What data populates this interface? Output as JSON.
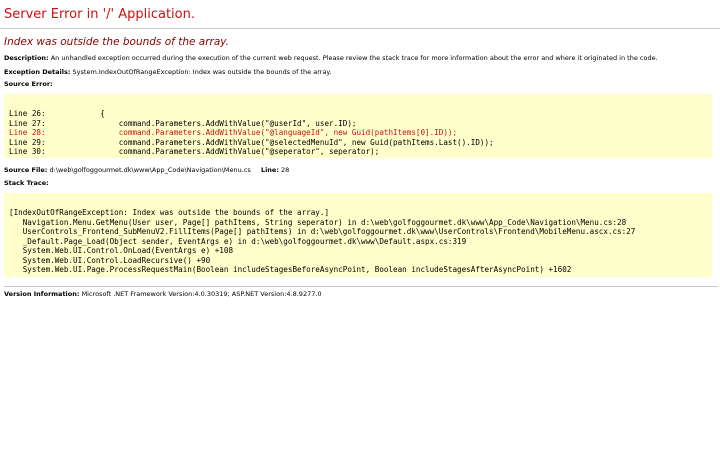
{
  "header": {
    "title": "Server Error in '/' Application.",
    "subtitle": "Index was outside the bounds of the array."
  },
  "description": {
    "label": "Description:",
    "text": "An unhandled exception occurred during the execution of the current web request. Please review the stack trace for more information about the error and where it originated in the code."
  },
  "exception": {
    "label": "Exception Details:",
    "text": "System.IndexOutOfRangeException: Index was outside the bounds of the array."
  },
  "source_error": {
    "label": "Source Error:",
    "lines": [
      "Line 26:            {",
      "Line 27:                command.Parameters.AddWithValue(\"@userId\", user.ID);",
      "Line 28:                command.Parameters.AddWithValue(\"@languageId\", new Guid(pathItems[0].ID));",
      "Line 29:                command.Parameters.AddWithValue(\"@selectedMenuId\", new Guid(pathItems.Last().ID));",
      "Line 30:                command.Parameters.AddWithValue(\"@seperator\", seperator);"
    ],
    "highlight_color": "#cc1111"
  },
  "source_file": {
    "label": "Source File:",
    "path": "d:\\web\\golfoggourmet.dk\\www\\App_Code\\Navigation\\Menu.cs",
    "line_label": "Line:",
    "line": "28"
  },
  "stack_trace": {
    "label": "Stack Trace:",
    "lines": [
      "[IndexOutOfRangeException: Index was outside the bounds of the array.]",
      "   Navigation.Menu.GetMenu(User user, Page[] pathItems, String seperator) in d:\\web\\golfoggourmet.dk\\www\\App_Code\\Navigation\\Menu.cs:28",
      "   UserControls_Frontend_SubMenuV2.FillItems(Page[] pathItems) in d:\\web\\golfoggourmet.dk\\www\\UserControls\\Frontend\\MobileMenu.ascx.cs:27",
      "   _Default.Page_Load(Object sender, EventArgs e) in d:\\web\\golfoggourmet.dk\\www\\Default.aspx.cs:319",
      "   System.Web.UI.Control.OnLoad(EventArgs e) +108",
      "   System.Web.UI.Control.LoadRecursive() +90",
      "   System.Web.UI.Page.ProcessRequestMain(Boolean includeStagesBeforeAsyncPoint, Boolean includeStagesAfterAsyncPoint) +1602"
    ]
  },
  "version": {
    "label": "Version Information:",
    "text": "Microsoft .NET Framework Version:4.0.30319; ASP.NET Version:4.8.9277.0"
  },
  "colors": {
    "title": "#cc1111",
    "subtitle": "#8b0000",
    "code_background": "#ffffcc"
  }
}
